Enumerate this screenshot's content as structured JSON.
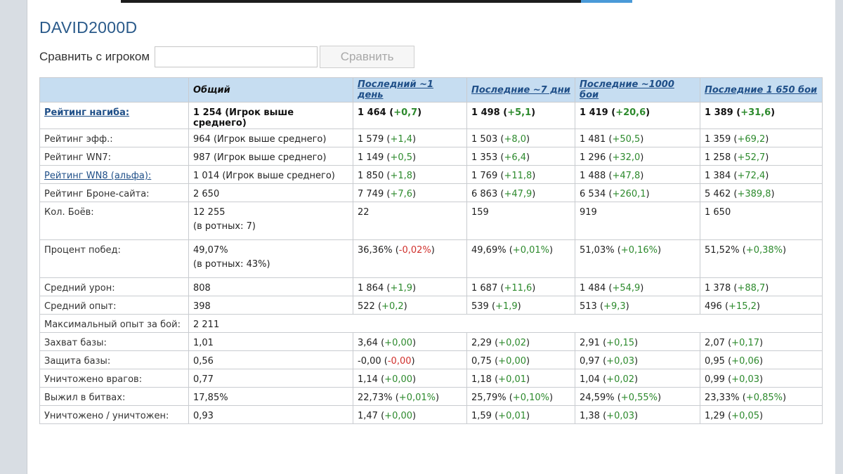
{
  "player": {
    "name": "DAVID2000D"
  },
  "compare": {
    "label": "Сравнить с игроком",
    "input_value": "",
    "input_placeholder": "",
    "button_label": "Сравнить"
  },
  "table": {
    "headers": [
      "",
      "Общий",
      "Последний ~1 день",
      "Последние ~7 дни",
      "Последние ~1000 бои",
      "Последние 1 650 бои"
    ],
    "rows": [
      {
        "label": "Рейтинг нагиба:",
        "bold": true,
        "label_link": true,
        "overall": "1 254 (Игрок выше среднего)",
        "periods": [
          [
            "1 464",
            "+0,7"
          ],
          [
            "1 498",
            "+5,1"
          ],
          [
            "1 419",
            "+20,6"
          ],
          [
            "1 389",
            "+31,6"
          ]
        ]
      },
      {
        "label": "Рейтинг эфф.:",
        "overall": "964 (Игрок выше среднего)",
        "periods": [
          [
            "1 579",
            "+1,4"
          ],
          [
            "1 503",
            "+8,0"
          ],
          [
            "1 481",
            "+50,5"
          ],
          [
            "1 359",
            "+69,2"
          ]
        ]
      },
      {
        "label": "Рейтинг WN7:",
        "overall": "987 (Игрок выше среднего)",
        "periods": [
          [
            "1 149",
            "+0,5"
          ],
          [
            "1 353",
            "+6,4"
          ],
          [
            "1 296",
            "+32,0"
          ],
          [
            "1 258",
            "+52,7"
          ]
        ]
      },
      {
        "label": "Рейтинг WN8 (альфа):",
        "label_link": true,
        "overall": "1 014 (Игрок выше среднего)",
        "periods": [
          [
            "1 850",
            "+1,8"
          ],
          [
            "1 769",
            "+11,8"
          ],
          [
            "1 488",
            "+47,8"
          ],
          [
            "1 384",
            "+72,4"
          ]
        ]
      },
      {
        "label": "Рейтинг Броне-сайта:",
        "overall": "2 650",
        "periods": [
          [
            "7 749",
            "+7,6"
          ],
          [
            "6 863",
            "+47,9"
          ],
          [
            "6 534",
            "+260,1"
          ],
          [
            "5 462",
            "+389,8"
          ]
        ]
      },
      {
        "label": "Кол. Боёв:",
        "tall": true,
        "overall": "12 255",
        "overall_sub": "(в ротных: 7)",
        "periods": [
          [
            "22",
            ""
          ],
          [
            "159",
            ""
          ],
          [
            "919",
            ""
          ],
          [
            "1 650",
            ""
          ]
        ]
      },
      {
        "label": "Процент побед:",
        "tall": true,
        "overall": "49,07%",
        "overall_sub": "(в ротных: 43%)",
        "periods": [
          [
            "36,36%",
            "-0,02%"
          ],
          [
            "49,69%",
            "+0,01%"
          ],
          [
            "51,03%",
            "+0,16%"
          ],
          [
            "51,52%",
            "+0,38%"
          ]
        ]
      },
      {
        "label": "Средний урон:",
        "overall": "808",
        "periods": [
          [
            "1 864",
            "+1,9"
          ],
          [
            "1 687",
            "+11,6"
          ],
          [
            "1 484",
            "+54,9"
          ],
          [
            "1 378",
            "+88,7"
          ]
        ]
      },
      {
        "label": "Средний опыт:",
        "overall": "398",
        "periods": [
          [
            "522",
            "+0,2"
          ],
          [
            "539",
            "+1,9"
          ],
          [
            "513",
            "+9,3"
          ],
          [
            "496",
            "+15,2"
          ]
        ]
      },
      {
        "label": "Максимальный опыт за бой:",
        "span": true,
        "overall": "2 211",
        "periods": []
      },
      {
        "label": "Захват базы:",
        "overall": "1,01",
        "periods": [
          [
            "3,64",
            "+0,00"
          ],
          [
            "2,29",
            "+0,02"
          ],
          [
            "2,91",
            "+0,15"
          ],
          [
            "2,07",
            "+0,17"
          ]
        ]
      },
      {
        "label": "Защита базы:",
        "overall": "0,56",
        "periods": [
          [
            "-0,00",
            "-0,00"
          ],
          [
            "0,75",
            "+0,00"
          ],
          [
            "0,97",
            "+0,03"
          ],
          [
            "0,95",
            "+0,06"
          ]
        ]
      },
      {
        "label": "Уничтожено врагов:",
        "overall": "0,77",
        "periods": [
          [
            "1,14",
            "+0,00"
          ],
          [
            "1,18",
            "+0,01"
          ],
          [
            "1,04",
            "+0,02"
          ],
          [
            "0,99",
            "+0,03"
          ]
        ]
      },
      {
        "label": "Выжил в битвах:",
        "overall": "17,85%",
        "periods": [
          [
            "22,73%",
            "+0,01%"
          ],
          [
            "25,79%",
            "+0,10%"
          ],
          [
            "24,59%",
            "+0,55%"
          ],
          [
            "23,33%",
            "+0,85%"
          ]
        ]
      },
      {
        "label": "Уничтожено / уничтожен:",
        "overall": "0,93",
        "periods": [
          [
            "1,47",
            "+0,00"
          ],
          [
            "1,59",
            "+0,01"
          ],
          [
            "1,38",
            "+0,03"
          ],
          [
            "1,29",
            "+0,05"
          ]
        ]
      }
    ]
  },
  "colors": {
    "positive": "#2d8a2d",
    "negative": "#d0302c",
    "header_bg": "#c6ddf1",
    "link": "#1f4f88",
    "title": "#2a5a8a"
  }
}
